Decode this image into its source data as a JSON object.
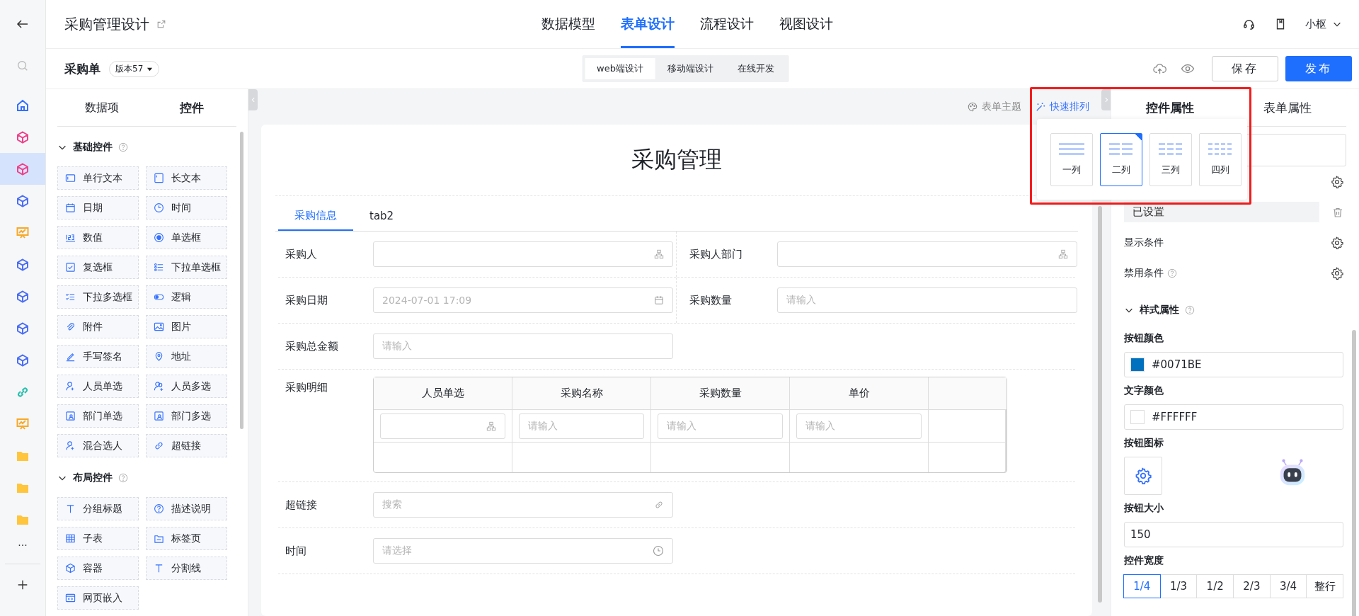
{
  "nav_rail": {
    "items": [
      {
        "kind": "home",
        "color": "#3370ff",
        "selected": false
      },
      {
        "kind": "cube",
        "color": "#f0408a",
        "selected": false
      },
      {
        "kind": "cube",
        "color": "#f0408a",
        "selected": true
      },
      {
        "kind": "cube",
        "color": "#4c6ef5",
        "selected": false
      },
      {
        "kind": "board",
        "color": "#f7a928",
        "selected": false
      },
      {
        "kind": "cube",
        "color": "#4c6ef5",
        "selected": false
      },
      {
        "kind": "cube",
        "color": "#4c6ef5",
        "selected": false
      },
      {
        "kind": "cube",
        "color": "#4c6ef5",
        "selected": false
      },
      {
        "kind": "cube",
        "color": "#4c6ef5",
        "selected": false
      },
      {
        "kind": "link",
        "color": "#2bbfae",
        "selected": false
      },
      {
        "kind": "board",
        "color": "#f7a928",
        "selected": false
      },
      {
        "kind": "folder",
        "color": "#ffc53d",
        "selected": false
      },
      {
        "kind": "folder",
        "color": "#ffc53d",
        "selected": false
      },
      {
        "kind": "folder",
        "color": "#ffc53d",
        "selected": false
      }
    ],
    "more": "···"
  },
  "header": {
    "title": "采购管理设计",
    "tabs": [
      {
        "label": "数据模型",
        "selected": false
      },
      {
        "label": "表单设计",
        "selected": true
      },
      {
        "label": "流程设计",
        "selected": false
      },
      {
        "label": "视图设计",
        "selected": false
      }
    ],
    "user": "小枢"
  },
  "toolbar": {
    "form_name": "采购单",
    "version": "版本57",
    "modes": [
      {
        "label": "web端设计",
        "selected": true
      },
      {
        "label": "移动端设计",
        "selected": false
      },
      {
        "label": "在线开发",
        "selected": false
      }
    ],
    "save": "保存",
    "publish": "发布"
  },
  "left_panel": {
    "tabs": [
      {
        "label": "数据项",
        "selected": false
      },
      {
        "label": "控件",
        "selected": true
      }
    ],
    "sections": [
      {
        "title": "基础控件",
        "expanded": true,
        "items": [
          "单行文本",
          "长文本",
          "日期",
          "时间",
          "数值",
          "单选框",
          "复选框",
          "下拉单选框",
          "下拉多选框",
          "逻辑",
          "附件",
          "图片",
          "手写签名",
          "地址",
          "人员单选",
          "人员多选",
          "部门单选",
          "部门多选",
          "混合选人",
          "超链接"
        ]
      },
      {
        "title": "布局控件",
        "expanded": true,
        "items": [
          "分组标题",
          "描述说明",
          "子表",
          "标签页",
          "容器",
          "分割线",
          "网页嵌入"
        ]
      }
    ]
  },
  "canvas": {
    "theme": "表单主题",
    "quick_arrange": "快速排列",
    "form": {
      "title": "采购管理",
      "tabs": [
        {
          "label": "采购信息",
          "selected": true
        },
        {
          "label": "tab2",
          "selected": false
        }
      ],
      "rows": [
        {
          "fields": [
            {
              "label": "采购人",
              "kind": "org"
            },
            {
              "label": "采购人部门",
              "kind": "org"
            }
          ]
        },
        {
          "fields": [
            {
              "label": "采购日期",
              "kind": "date",
              "placeholder": "2024-07-01 17:09"
            },
            {
              "label": "采购数量",
              "kind": "text",
              "placeholder": "请输入"
            }
          ]
        },
        {
          "fields": [
            {
              "label": "采购总金额",
              "kind": "text",
              "placeholder": "请输入"
            }
          ]
        },
        {
          "fields": [
            {
              "label": "采购明细",
              "kind": "table",
              "columns": [
                "人员单选",
                "采购名称",
                "采购数量",
                "单价"
              ],
              "cells": [
                {
                  "kind": "org"
                },
                {
                  "kind": "text",
                  "placeholder": "请输入"
                },
                {
                  "kind": "text",
                  "placeholder": "请输入"
                },
                {
                  "kind": "text",
                  "placeholder": "请输入"
                }
              ]
            }
          ]
        },
        {
          "fields": [
            {
              "label": "超链接",
              "kind": "link",
              "placeholder": "搜索"
            }
          ]
        },
        {
          "fields": [
            {
              "label": "时间",
              "kind": "time",
              "placeholder": "请选择"
            }
          ]
        }
      ]
    }
  },
  "arrange_popover": {
    "options": [
      {
        "label": "一列",
        "selected": false
      },
      {
        "label": "二列",
        "selected": true
      },
      {
        "label": "三列",
        "selected": false
      },
      {
        "label": "四列",
        "selected": false
      }
    ]
  },
  "right_panel": {
    "tabs": [
      {
        "label": "控件属性",
        "selected": true
      },
      {
        "label": "表单属性",
        "selected": false
      }
    ],
    "configured": "已设置",
    "show_condition": "显示条件",
    "disable_condition": "禁用条件",
    "style_section": "样式属性",
    "button_color": {
      "label": "按钮颜色",
      "value": "#0071BE"
    },
    "text_color": {
      "label": "文字颜色",
      "value": "#FFFFFF"
    },
    "button_icon": {
      "label": "按钮图标"
    },
    "button_size": {
      "label": "按钮大小",
      "value": "150"
    },
    "width": {
      "label": "控件宽度",
      "options": [
        {
          "label": "1/4",
          "selected": true
        },
        {
          "label": "1/3",
          "selected": false
        },
        {
          "label": "1/2",
          "selected": false
        },
        {
          "label": "2/3",
          "selected": false
        },
        {
          "label": "3/4",
          "selected": false
        },
        {
          "label": "整行",
          "selected": false
        }
      ]
    }
  }
}
